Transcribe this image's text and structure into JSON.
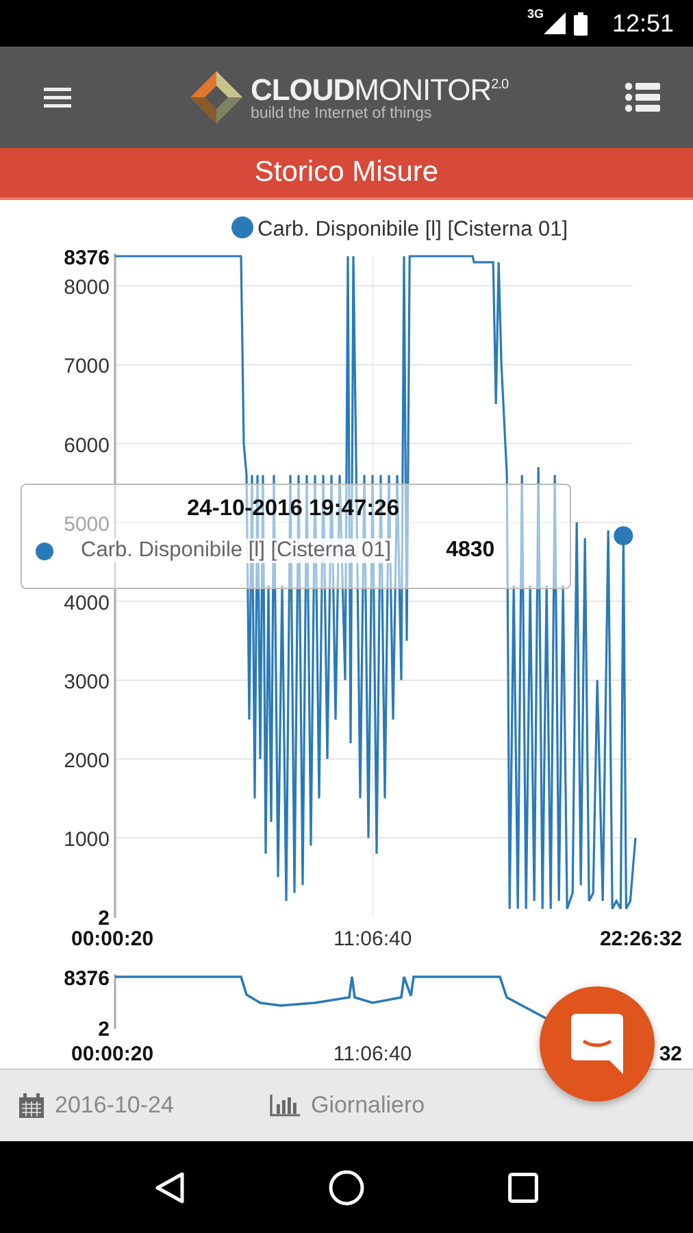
{
  "status_bar": {
    "network": "3G",
    "time": "12:51"
  },
  "app_bar": {
    "logo_text": "**CLOUD**MONITOR$^{2.0}$",
    "tagline": "build the Internet of things"
  },
  "page_title": "Storico Misure",
  "chart": {
    "chart_data": {
      "type": "line",
      "xlim": [
        20,
        80792
      ],
      "ylim": [
        2,
        8376
      ],
      "x": [
        20,
        19568,
        19994,
        20419,
        20845,
        21270,
        21695,
        22121,
        22546,
        22972,
        23397,
        23822,
        24248,
        24673,
        25311,
        25949,
        26588,
        27226,
        27864,
        28502,
        29140,
        29778,
        30416,
        31054,
        31692,
        32330,
        32969,
        33607,
        34245,
        34883,
        35734,
        36159,
        36584,
        37010,
        37435,
        38073,
        38711,
        39350,
        39988,
        40626,
        41264,
        41902,
        42540,
        43178,
        43816,
        44454,
        44880,
        45305,
        45731,
        46369,
        55515,
        55727,
        58705,
        59131,
        59556,
        59981,
        60832,
        61258,
        61896,
        62534,
        63172,
        63810,
        64448,
        65086,
        65724,
        66362,
        67001,
        67639,
        68277,
        68915,
        69553,
        70191,
        71042,
        71680,
        72318,
        72956,
        73594,
        74232,
        74870,
        75721,
        76572,
        77210,
        77848,
        78486,
        78912,
        79337,
        79975,
        80792
      ],
      "series": [
        {
          "name": "Carb. Disponibile [l] [Cisterna 01]",
          "color": "#2a7ab8",
          "values": [
            8376,
            8376,
            6000,
            5600,
            2500,
            5600,
            1500,
            5600,
            2000,
            5600,
            800,
            4200,
            1200,
            5600,
            500,
            4200,
            200,
            5600,
            300,
            5600,
            400,
            5600,
            900,
            5600,
            1500,
            5600,
            2000,
            5600,
            2500,
            5600,
            3000,
            8376,
            2200,
            8376,
            5800,
            1500,
            5600,
            1000,
            5600,
            800,
            5600,
            1500,
            5600,
            2500,
            5600,
            3000,
            8376,
            3500,
            8376,
            8376,
            8376,
            8300,
            8300,
            6500,
            8300,
            7000,
            5600,
            100,
            4200,
            100,
            5600,
            100,
            4200,
            200,
            5700,
            100,
            4200,
            100,
            5600,
            200,
            4200,
            100,
            300,
            5000,
            400,
            4800,
            200,
            300,
            3000,
            200,
            4900,
            100,
            200,
            100,
            4830,
            100,
            200,
            1000
          ]
        }
      ],
      "grid": true,
      "ref_lines": [
        {
          "axis": "x",
          "value": 40000
        }
      ],
      "xticks": [
        {
          "value": 20,
          "label": "00:00:20"
        },
        {
          "value": 40000,
          "label": "11:06:40"
        },
        {
          "value": 80792,
          "label": "22:26:32"
        }
      ],
      "yticks": [
        {
          "value": 2,
          "label": "2"
        },
        1000,
        2000,
        3000,
        4000,
        5000,
        6000,
        7000,
        8000,
        {
          "value": 8376,
          "label": "8376"
        }
      ]
    },
    "tooltip": {
      "title": "24-10-2016 19:47:26",
      "series": "Carb. Disponibile [l] [Cisterna 01]",
      "value": "4830"
    }
  },
  "navigator": {
    "y_labels": [
      "8376",
      "2"
    ],
    "x_labels": [
      "00:00:20",
      "11:06:40",
      "32"
    ]
  },
  "footer": {
    "date": "2016-10-24",
    "period": "Giornaliero"
  }
}
